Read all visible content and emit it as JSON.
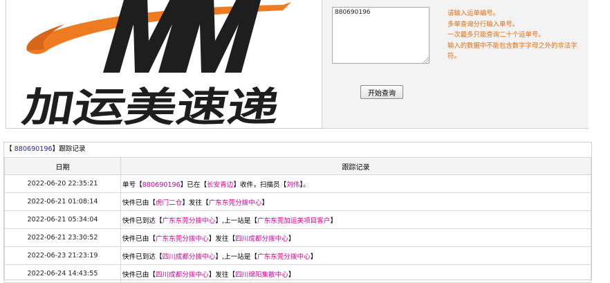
{
  "logo": {
    "company_name": "加运美速递",
    "brand_letters": "MM"
  },
  "query": {
    "input_value": "880690196",
    "tips": [
      "请输入运单编号。",
      "多单查询分行输入单号。",
      "一次最多只能查询二十个运单号。",
      "输入的数据中不能包含数字字母之外的非法字符。"
    ],
    "button_label": "开始查询"
  },
  "tracking": {
    "title_open": "【 ",
    "number": "880690196",
    "title_close": "】跟踪记录",
    "columns": [
      "日期",
      "跟踪记录"
    ],
    "rows": [
      {
        "date": "2022-06-20 22:35:21",
        "parts": [
          [
            "单号【",
            false
          ],
          [
            "880690196",
            true
          ],
          [
            "】已在【",
            false
          ],
          [
            "长安青边",
            true
          ],
          [
            "】收件，扫描员【",
            false
          ],
          [
            "刘伟",
            true
          ],
          [
            "】。",
            false
          ]
        ]
      },
      {
        "date": "2022-06-21 01:08:14",
        "parts": [
          [
            "快件已由【",
            false
          ],
          [
            "虎门二仓",
            true
          ],
          [
            "】发往【",
            false
          ],
          [
            "广东东莞分拨中心",
            true
          ],
          [
            "】",
            false
          ]
        ]
      },
      {
        "date": "2022-06-21 05:34:04",
        "parts": [
          [
            "快件已到达【",
            false
          ],
          [
            "广东东莞分拨中心",
            true
          ],
          [
            "】,上一站是【",
            false
          ],
          [
            "广东东莞加运美项目客户",
            true
          ],
          [
            "】",
            false
          ]
        ]
      },
      {
        "date": "2022-06-21 23:30:52",
        "parts": [
          [
            "快件已由【",
            false
          ],
          [
            "广东东莞分拨中心",
            true
          ],
          [
            "】发往【",
            false
          ],
          [
            "四川成都分拨中心",
            true
          ],
          [
            "】",
            false
          ]
        ]
      },
      {
        "date": "2022-06-23 21:23:19",
        "parts": [
          [
            "快件已到达【",
            false
          ],
          [
            "四川成都分拨中心",
            true
          ],
          [
            "】,上一站是【",
            false
          ],
          [
            "广东东莞分拨中心",
            true
          ],
          [
            "】",
            false
          ]
        ]
      },
      {
        "date": "2022-06-24 14:43:55",
        "parts": [
          [
            "快件已由【",
            false
          ],
          [
            "四川成都分拨中心",
            true
          ],
          [
            "】发往【",
            false
          ],
          [
            "四川绵阳集散中心",
            true
          ],
          [
            "】",
            false
          ]
        ]
      }
    ]
  },
  "colors": {
    "tips": "#e46b0e",
    "highlight": "#e0009a",
    "number": "#2222cc",
    "logo_orange": "#ee7a22",
    "logo_dark": "#1e1e1e"
  }
}
